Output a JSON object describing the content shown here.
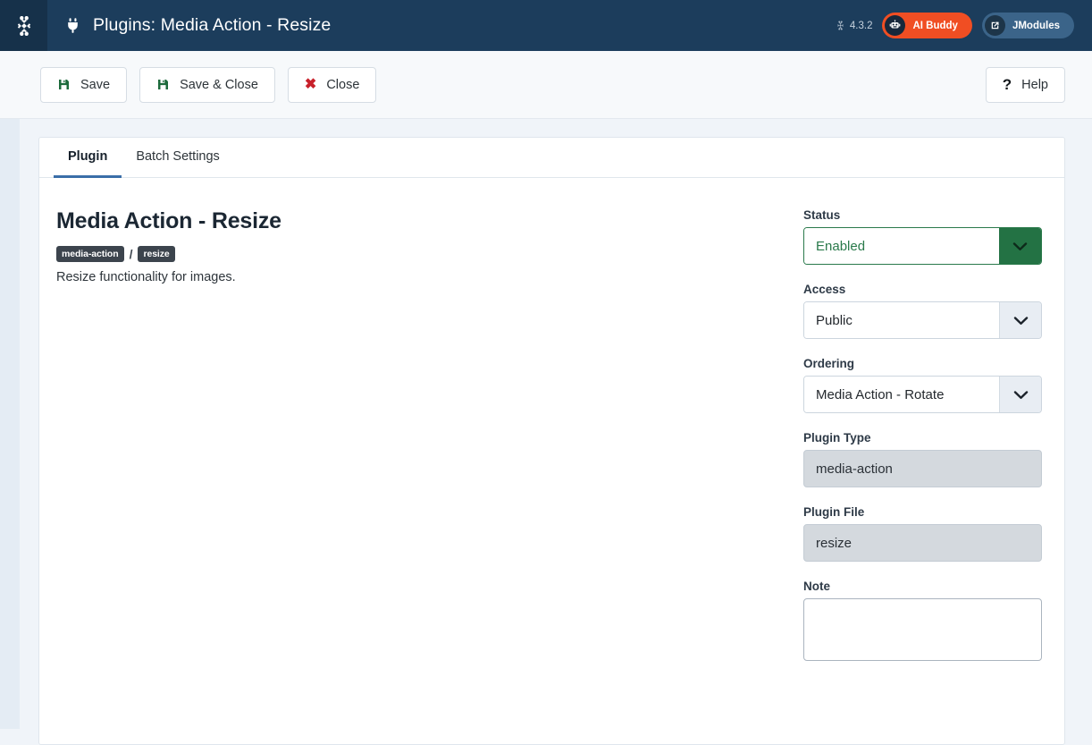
{
  "header": {
    "logo_icon": "joomla-logo",
    "page_icon": "plug-icon",
    "title": "Plugins: Media Action - Resize",
    "version": "4.3.2",
    "version_icon": "joomla-mini-icon",
    "pills": [
      {
        "label": "AI Buddy",
        "icon": "robot-icon",
        "color": "#f04e23"
      },
      {
        "label": "JModules",
        "icon": "external-link-icon",
        "color": "#3b6489"
      }
    ]
  },
  "toolbar": {
    "save_label": "Save",
    "save_close_label": "Save & Close",
    "close_label": "Close",
    "help_label": "Help",
    "close_glyph": "✖",
    "help_glyph": "?"
  },
  "tabs": [
    {
      "label": "Plugin",
      "active": true
    },
    {
      "label": "Batch Settings",
      "active": false
    }
  ],
  "plugin": {
    "title": "Media Action - Resize",
    "type_badge": "media-action",
    "separator": "/",
    "file_badge": "resize",
    "description": "Resize functionality for images."
  },
  "form": {
    "status": {
      "label": "Status",
      "value": "Enabled",
      "color": "#237244"
    },
    "access": {
      "label": "Access",
      "value": "Public"
    },
    "ordering": {
      "label": "Ordering",
      "value": "Media Action - Rotate"
    },
    "plugin_type": {
      "label": "Plugin Type",
      "value": "media-action"
    },
    "plugin_file": {
      "label": "Plugin File",
      "value": "resize"
    },
    "note": {
      "label": "Note",
      "value": "",
      "placeholder": ""
    }
  }
}
